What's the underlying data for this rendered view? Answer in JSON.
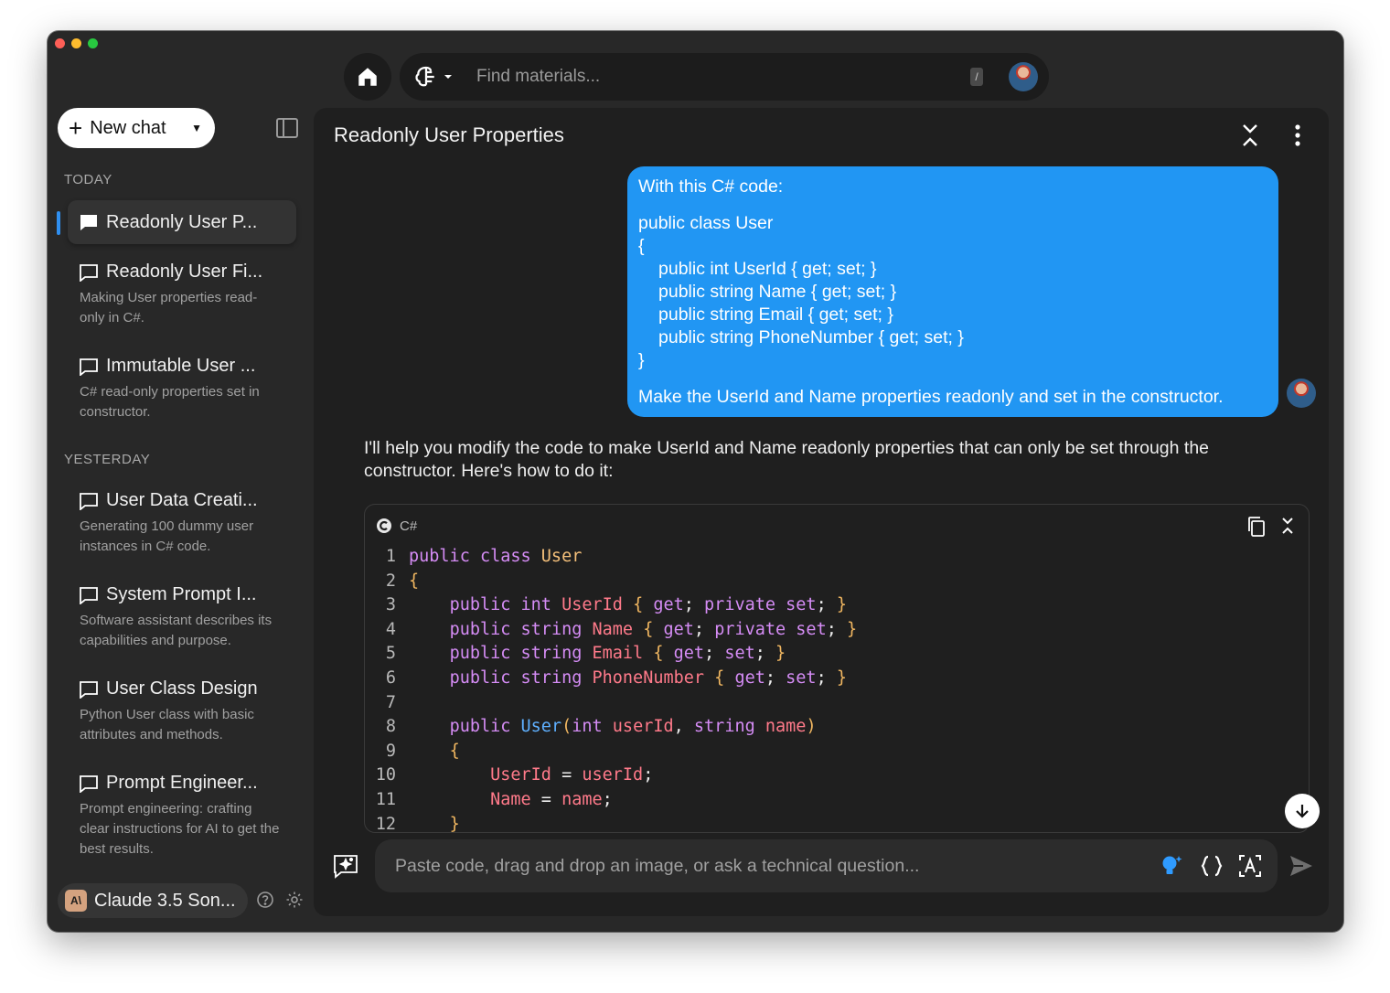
{
  "topbar": {
    "search_placeholder": "Find materials...",
    "shortcut_key": "/"
  },
  "sidebar": {
    "new_chat_label": "New chat",
    "sections": [
      {
        "label": "TODAY"
      },
      {
        "label": "YESTERDAY"
      }
    ],
    "items": [
      {
        "title": "Readonly User P...",
        "desc": ""
      },
      {
        "title": "Readonly User Fi...",
        "desc": "Making User properties read-only in C#."
      },
      {
        "title": "Immutable User ...",
        "desc": "C# read-only properties set in constructor."
      },
      {
        "title": "User Data Creati...",
        "desc": "Generating 100 dummy user instances in C# code."
      },
      {
        "title": "System Prompt I...",
        "desc": "Software assistant describes its capabilities and purpose."
      },
      {
        "title": "User Class Design",
        "desc": "Python User class with basic attributes and methods."
      },
      {
        "title": "Prompt Engineer...",
        "desc": "Prompt engineering: crafting clear instructions for AI to get the best results."
      }
    ],
    "model": {
      "logo_text": "A\\",
      "name": "Claude 3.5 Son..."
    }
  },
  "conversation": {
    "title": "Readonly User Properties",
    "user_message": {
      "intro": "With this C# code:",
      "code": [
        "public class User",
        "{",
        "public int UserId { get; set; }",
        "public string Name { get; set; }",
        "public string Email { get; set; }",
        "public string PhoneNumber { get; set; }",
        "}"
      ],
      "request": "Make the UserId and Name properties readonly and set in the constructor."
    },
    "assistant_text": "I'll help you modify the code to make UserId and Name readonly properties that can only be set through the constructor. Here's how to do it:",
    "code_block": {
      "language": "C#",
      "line_numbers": [
        "1",
        "2",
        "3",
        "4",
        "5",
        "6",
        "7",
        "8",
        "9",
        "10",
        "11",
        "12"
      ]
    }
  },
  "composer": {
    "placeholder": "Paste code, drag and drop an image, or ask a technical question..."
  },
  "colors": {
    "accent": "#2196f3",
    "window_bg": "#282828",
    "panel_bg": "#1f1f1f"
  }
}
